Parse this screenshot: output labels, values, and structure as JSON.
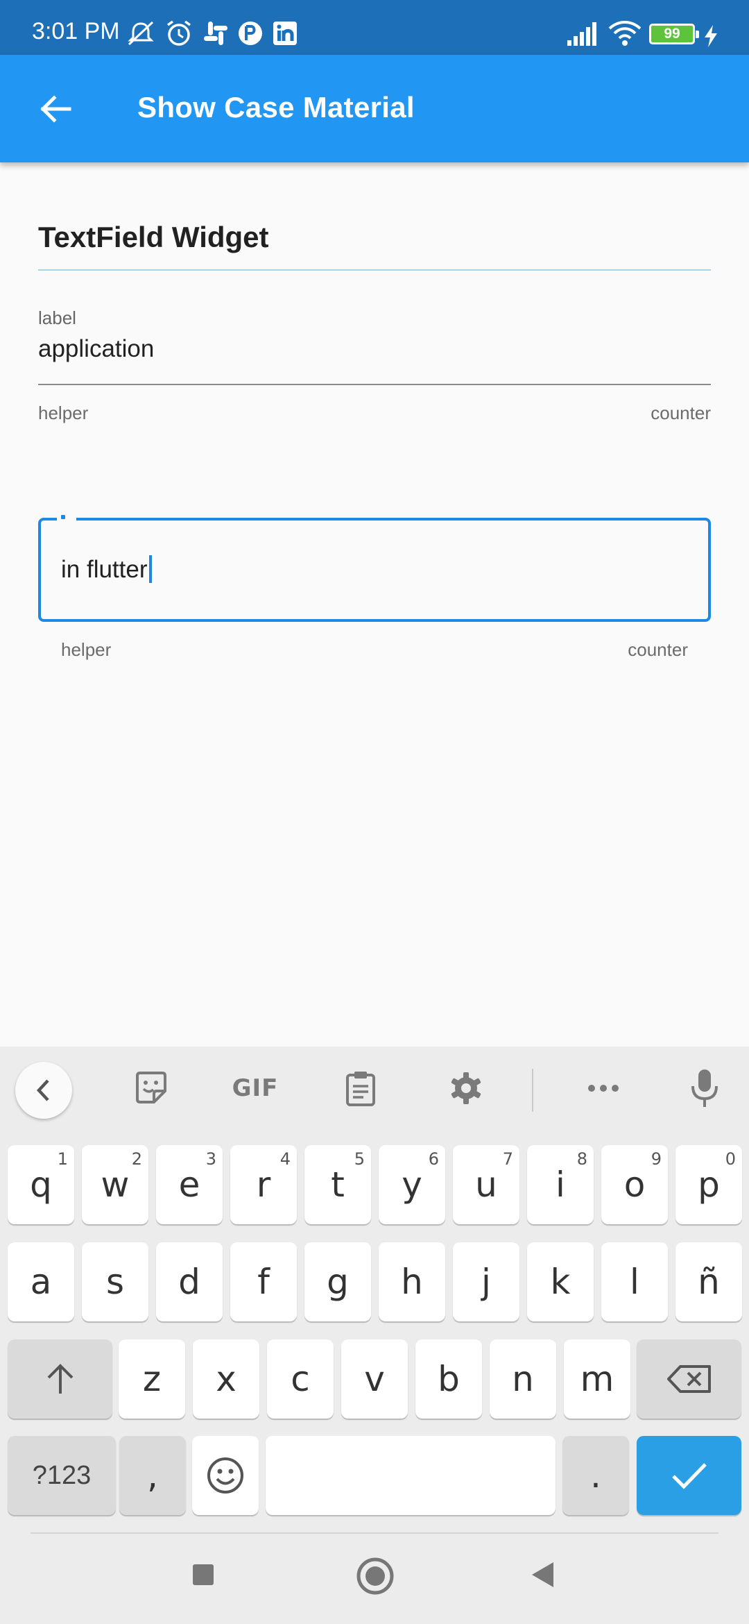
{
  "status_bar": {
    "time": "3:01 PM",
    "battery": "99",
    "icons": [
      "mute-bell-icon",
      "alarm-icon",
      "slack-icon",
      "app-icon",
      "linkedin-icon",
      "signal-icon",
      "wifi-icon",
      "battery-icon",
      "charging-icon"
    ]
  },
  "app_bar": {
    "title": "Show Case Material",
    "back_icon": "arrow-back-icon"
  },
  "content": {
    "section_title": "TextField Widget",
    "field1": {
      "label": "label",
      "value": "application",
      "helper": "helper",
      "counter": "counter"
    },
    "field2": {
      "value": "in flutter",
      "helper": "helper",
      "counter": "counter"
    }
  },
  "keyboard": {
    "toolbar": [
      "collapse-icon",
      "sticker-icon",
      "GIF",
      "clipboard-icon",
      "settings-icon",
      "more-icon",
      "mic-icon"
    ],
    "row1": [
      {
        "k": "q",
        "h": "1"
      },
      {
        "k": "w",
        "h": "2"
      },
      {
        "k": "e",
        "h": "3"
      },
      {
        "k": "r",
        "h": "4"
      },
      {
        "k": "t",
        "h": "5"
      },
      {
        "k": "y",
        "h": "6"
      },
      {
        "k": "u",
        "h": "7"
      },
      {
        "k": "i",
        "h": "8"
      },
      {
        "k": "o",
        "h": "9"
      },
      {
        "k": "p",
        "h": "0"
      }
    ],
    "row2": [
      "a",
      "s",
      "d",
      "f",
      "g",
      "h",
      "j",
      "k",
      "l",
      "ñ"
    ],
    "row3": [
      "z",
      "x",
      "c",
      "v",
      "b",
      "n",
      "m"
    ],
    "row4": {
      "symbols": "?123",
      "comma": ",",
      "period": "."
    },
    "accent_color": "#2a9fe6"
  },
  "nav_bar": [
    "recents-square-icon",
    "home-circle-icon",
    "back-triangle-icon"
  ],
  "colors": {
    "status_bar": "#1d6fb8",
    "app_bar": "#2196f3",
    "focus": "#1e88e5"
  }
}
